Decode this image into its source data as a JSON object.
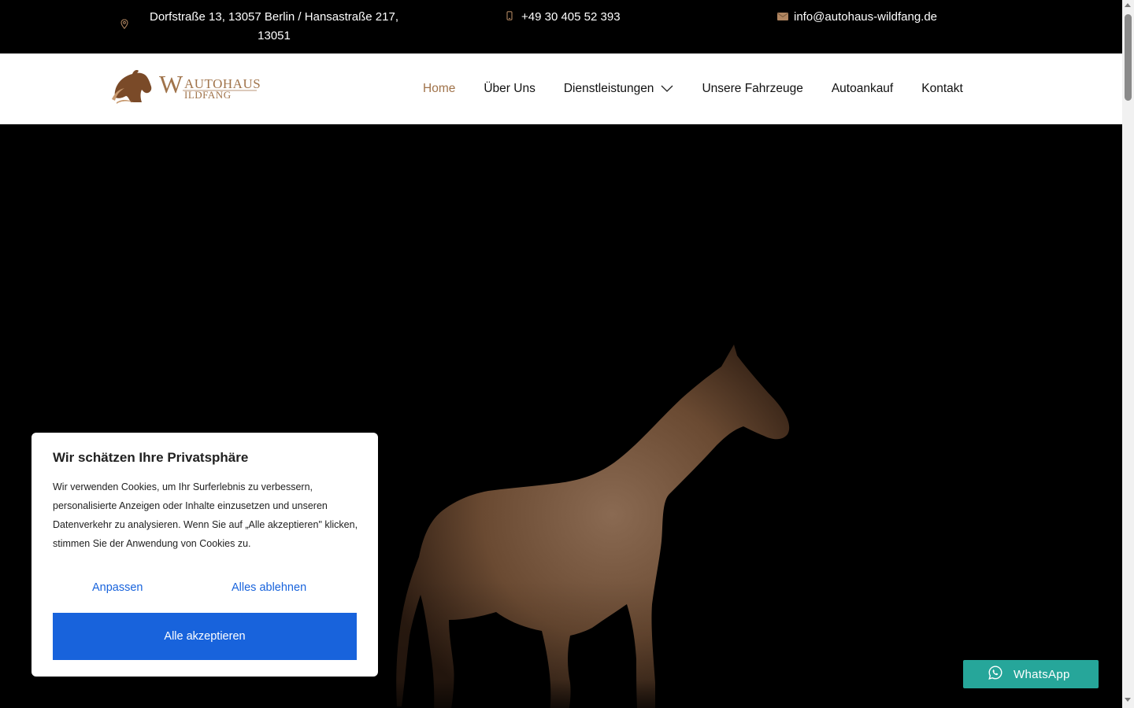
{
  "topbar": {
    "address": "Dorfstraße 13, 13057 Berlin / Hansastraße 217, 13051",
    "phone": "+49 30 405 52 393",
    "email": "info@autohaus-wildfang.de",
    "icons": [
      "location-pin-icon",
      "phone-icon",
      "mail-icon"
    ]
  },
  "logo": {
    "line1": "AUTOHAUS",
    "line2": "WILDFANG"
  },
  "nav": {
    "items": [
      {
        "label": "Home",
        "active": true
      },
      {
        "label": "Über Uns"
      },
      {
        "label": "Dienstleistungen",
        "has_dropdown": true
      },
      {
        "label": "Unsere Fahrzeuge"
      },
      {
        "label": "Autoankauf"
      },
      {
        "label": "Kontakt"
      }
    ]
  },
  "cookie": {
    "title": "Wir schätzen Ihre Privatsphäre",
    "text": "Wir verwenden Cookies, um Ihr Surferlebnis zu verbessern, personalisierte Anzeigen oder Inhalte einzusetzen und unseren Datenverkehr zu analysieren. Wenn Sie auf „Alle akzeptieren\" klicken, stimmen Sie der Anwendung von Cookies zu.",
    "customize_label": "Anpassen",
    "reject_label": "Alles ablehnen",
    "accept_label": "Alle akzeptieren"
  },
  "whatsapp": {
    "label": "WhatsApp"
  },
  "colors": {
    "accent": "#a0734a",
    "cookie_blue": "#1863dc",
    "whatsapp_green": "#26a69a"
  }
}
